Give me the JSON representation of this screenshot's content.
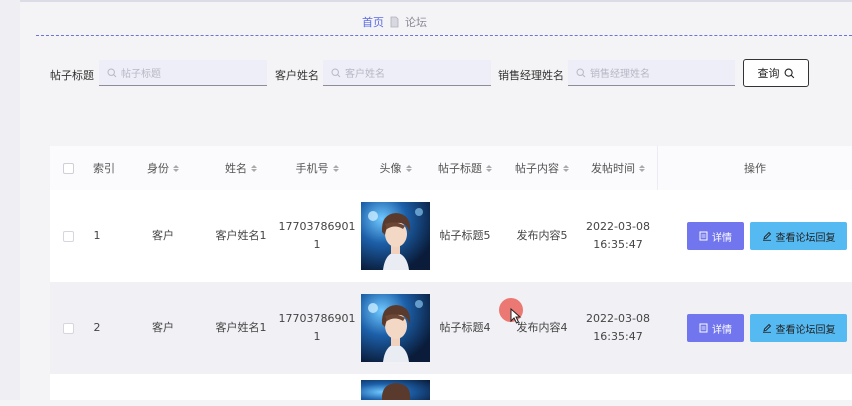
{
  "breadcrumb": {
    "home": "首页",
    "current": "论坛"
  },
  "search": {
    "title_label": "帖子标题",
    "title_placeholder": "帖子标题",
    "customer_label": "客户姓名",
    "customer_placeholder": "客户姓名",
    "manager_label": "销售经理姓名",
    "manager_placeholder": "销售经理姓名",
    "query_button": "查询"
  },
  "table": {
    "headers": {
      "index": "索引",
      "role": "身份",
      "name": "姓名",
      "phone": "手机号",
      "avatar": "头像",
      "post_title": "帖子标题",
      "post_content": "帖子内容",
      "post_time": "发帖时间",
      "actions": "操作"
    },
    "rows": [
      {
        "index": "1",
        "role": "客户",
        "name": "客户姓名1",
        "phone_line1": "17703786901",
        "phone_line2": "1",
        "post_title": "帖子标题5",
        "post_content": "发布内容5",
        "date": "2022-03-08",
        "time": "16:35:47"
      },
      {
        "index": "2",
        "role": "客户",
        "name": "客户姓名1",
        "phone_line1": "17703786901",
        "phone_line2": "1",
        "post_title": "帖子标题4",
        "post_content": "发布内容4",
        "date": "2022-03-08",
        "time": "16:35:47"
      }
    ],
    "detail_button": "详情",
    "reply_button": "查看论坛回复"
  },
  "colors": {
    "accent": "#5b6be0",
    "detail_btn": "#7276ee",
    "reply_btn": "#55b9f2",
    "input_bg": "#eeeef9"
  }
}
